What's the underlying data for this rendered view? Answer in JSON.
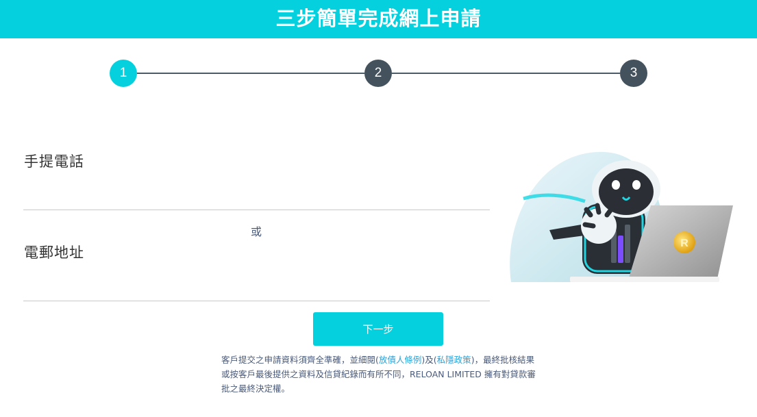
{
  "header": {
    "title": "三步簡單完成網上申請"
  },
  "steps": [
    "1",
    "2",
    "3"
  ],
  "form": {
    "phone_label": "手提電話",
    "phone_value": "",
    "or_text": "或",
    "email_label": "電郵地址",
    "email_value": "",
    "next_label": "下一步"
  },
  "disclaimer": {
    "part1": "客戶提交之申請資料須齊全準確，並細閱(",
    "link1": "放債人條例",
    "part2": ")及(",
    "link2": "私隱政策",
    "part3": ")，最終批核結果或按客戶最後提供之資料及信貸紀錄而有所不同，RELOAN LIMITED 擁有對貸款審批之最終決定權。"
  },
  "colors": {
    "accent": "#05d0de",
    "step_inactive": "#44525d",
    "link": "#2aa3d9"
  },
  "illustration": {
    "icon": "robot-with-laptop-illustration"
  }
}
